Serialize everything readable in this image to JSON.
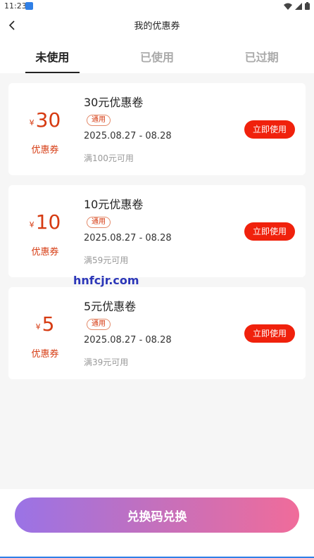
{
  "status_bar": {
    "time": "11:23",
    "icons": [
      "wifi-icon",
      "signal-icon",
      "battery-icon"
    ]
  },
  "header": {
    "title": "我的优惠券",
    "back_icon": "chevron-left-icon"
  },
  "tabs": [
    {
      "label": "未使用",
      "active": true
    },
    {
      "label": "已使用",
      "active": false
    },
    {
      "label": "已过期",
      "active": false
    }
  ],
  "coupons": [
    {
      "currency": "¥",
      "amount": "30",
      "left_label": "优惠券",
      "title": "30元优惠卷",
      "tag": "通用",
      "date": "2025.08.27 - 08.28",
      "min_use": "满100元可用",
      "button": "立即使用"
    },
    {
      "currency": "¥",
      "amount": "10",
      "left_label": "优惠券",
      "title": "10元优惠卷",
      "tag": "通用",
      "date": "2025.08.27 - 08.28",
      "min_use": "满59元可用",
      "button": "立即使用"
    },
    {
      "currency": "¥",
      "amount": "5",
      "left_label": "优惠券",
      "title": "5元优惠卷",
      "tag": "通用",
      "date": "2025.08.27 - 08.28",
      "min_use": "满39元可用",
      "button": "立即使用"
    }
  ],
  "watermark": "hnfcjr.com",
  "redeem_button": "兑换码兑换",
  "colors": {
    "accent_red": "#f0210c",
    "amount_red": "#d63b12",
    "gradient_start": "#9a73e6",
    "gradient_end": "#f06c9a"
  }
}
